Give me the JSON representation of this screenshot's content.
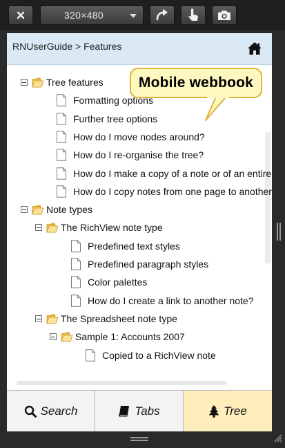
{
  "toolbar": {
    "close_icon": "close-icon",
    "size_value": "320×480",
    "rotate_icon": "rotate-icon",
    "touch_icon": "touch-icon",
    "camera_icon": "camera-icon"
  },
  "header": {
    "breadcrumb": "RNUserGuide > Features",
    "home_icon": "home-icon"
  },
  "callout": {
    "text": "Mobile webbook"
  },
  "tree": {
    "items": [
      {
        "label": "Tree features",
        "type": "folder",
        "level": 0,
        "expanded": true
      },
      {
        "label": "Formatting options",
        "type": "doc",
        "level": 1
      },
      {
        "label": "Further tree options",
        "type": "doc",
        "level": 1
      },
      {
        "label": "How do I move nodes around?",
        "type": "doc",
        "level": 1
      },
      {
        "label": "How do I re-organise the tree?",
        "type": "doc",
        "level": 1
      },
      {
        "label": "How do I make a copy of a note or of an entire su",
        "type": "doc",
        "level": 1
      },
      {
        "label": "How do I copy notes from one page to another p",
        "type": "doc",
        "level": 1
      },
      {
        "label": "Note types",
        "type": "folder",
        "level": 0,
        "expanded": true
      },
      {
        "label": "The RichView note type",
        "type": "folder",
        "level": 1,
        "expanded": true
      },
      {
        "label": "Predefined text styles",
        "type": "doc",
        "level": 2
      },
      {
        "label": "Predefined paragraph styles",
        "type": "doc",
        "level": 2
      },
      {
        "label": "Color palettes",
        "type": "doc",
        "level": 2
      },
      {
        "label": "How do I create a link to another note?",
        "type": "doc",
        "level": 2
      },
      {
        "label": "The Spreadsheet note type",
        "type": "folder",
        "level": 1,
        "expanded": true
      },
      {
        "label": "Sample 1: Accounts 2007",
        "type": "folder",
        "level": 2,
        "expanded": true
      },
      {
        "label": "Copied to a RichView note",
        "type": "doc",
        "level": 3
      }
    ]
  },
  "search": {
    "value": "",
    "placeholder": "",
    "icon": "search-icon"
  },
  "tabs": [
    {
      "label": "Search",
      "icon": "search-icon",
      "selected": false
    },
    {
      "label": "Tabs",
      "icon": "book-icon",
      "selected": false
    },
    {
      "label": "Tree",
      "icon": "tree-icon",
      "selected": true
    }
  ],
  "colors": {
    "header_bg": "#dae9f4",
    "callout_bg": "#fdf8bf",
    "callout_border": "#e2b13b",
    "selected_tab_bg": "#fdeebc",
    "app_background": "#2a2a2a"
  }
}
